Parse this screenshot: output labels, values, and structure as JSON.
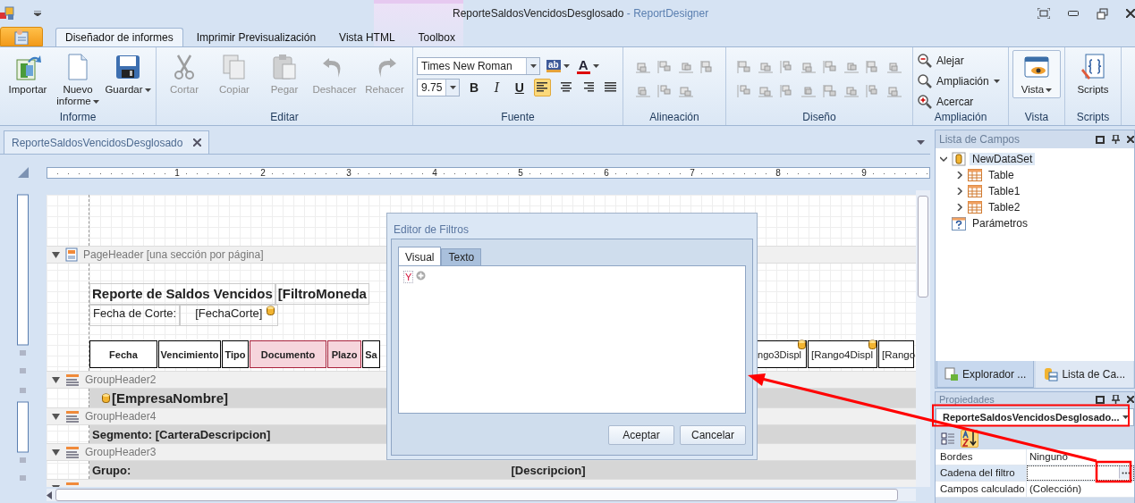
{
  "window": {
    "title": "ReporteSaldosVencidosDesglosado",
    "app_name": "- ReportDesigner"
  },
  "ribbon": {
    "tabs": [
      {
        "label": "Diseñador de informes",
        "selected": true
      },
      {
        "label": "Imprimir Previsualización",
        "selected": false
      },
      {
        "label": "Vista HTML",
        "selected": false
      },
      {
        "label": "Toolbox",
        "selected": false
      }
    ],
    "groups": [
      {
        "kind": "large",
        "label": "Informe",
        "buttons": [
          {
            "kind": "import",
            "label": "Importar",
            "disabled": false,
            "dropdown": false
          },
          {
            "kind": "new",
            "label": "Nuevo informe",
            "disabled": false,
            "dropdown": true
          },
          {
            "kind": "save",
            "label": "Guardar",
            "disabled": false,
            "dropdown": true
          }
        ]
      },
      {
        "kind": "large",
        "label": "Editar",
        "buttons": [
          {
            "kind": "cut",
            "label": "Cortar",
            "disabled": true,
            "dropdown": false
          },
          {
            "kind": "copy",
            "label": "Copiar",
            "disabled": true,
            "dropdown": false
          },
          {
            "kind": "paste",
            "label": "Pegar",
            "disabled": true,
            "dropdown": false
          },
          {
            "kind": "undo",
            "label": "Deshacer",
            "disabled": true,
            "dropdown": false
          },
          {
            "kind": "redo",
            "label": "Rehacer",
            "disabled": true,
            "dropdown": false
          }
        ]
      },
      {
        "kind": "font",
        "label": "Fuente",
        "font_name": "Times New Roman",
        "font_size": "9.75",
        "color_buttons": [
          {
            "kind": "highlight",
            "glyph": "ab"
          },
          {
            "kind": "font-color",
            "glyph": "A"
          }
        ],
        "styles": [
          {
            "kind": "bold",
            "label": "B",
            "selected": false
          },
          {
            "kind": "italic",
            "label": "I",
            "selected": false
          },
          {
            "kind": "underline",
            "label": "U",
            "selected": false
          }
        ],
        "alignments": [
          {
            "kind": "left",
            "selected": true
          },
          {
            "kind": "center",
            "selected": false
          },
          {
            "kind": "right",
            "selected": false
          },
          {
            "kind": "justify",
            "selected": false
          }
        ]
      },
      {
        "kind": "align",
        "label": "Alineación"
      },
      {
        "kind": "layout",
        "label": "Diseño"
      },
      {
        "kind": "zoom",
        "label": "Ampliación",
        "buttons": [
          {
            "kind": "zoom-out",
            "label": "Alejar",
            "dropdown": false
          },
          {
            "kind": "zoom",
            "label": "Ampliación",
            "dropdown": true
          },
          {
            "kind": "zoom-in",
            "label": "Acercar",
            "dropdown": false
          }
        ]
      },
      {
        "kind": "large",
        "label": "Vista",
        "buttons": [
          {
            "kind": "view",
            "label": "Vista",
            "disabled": false,
            "dropdown": true
          }
        ]
      },
      {
        "kind": "large",
        "label": "Scripts",
        "buttons": [
          {
            "kind": "scripts",
            "label": "Scripts",
            "disabled": false,
            "dropdown": false
          }
        ]
      }
    ]
  },
  "document": {
    "tab": {
      "title": "ReporteSaldosVencidosDesglosado",
      "selected": true
    },
    "ruler_labels": [
      "1",
      "2",
      "3",
      "4",
      "5",
      "6",
      "7",
      "8",
      "9"
    ],
    "page_header": {
      "title": "PageHeader [una sección por página]",
      "expanded": true,
      "title_cells": [
        "Reporte de Saldos Vencidos",
        "[FiltroMoneda"
      ],
      "info_cells": [
        {
          "text": "Fecha de Corte:",
          "bound": false
        },
        {
          "text": "[FechaCorte]",
          "bound": true
        }
      ],
      "columns_left": [
        {
          "text": "Fecha",
          "highlighted": false
        },
        {
          "text": "Vencimiento",
          "highlighted": false
        },
        {
          "text": "Tipo",
          "highlighted": false
        },
        {
          "text": "Documento",
          "highlighted": true
        },
        {
          "text": "Plazo",
          "highlighted": true
        },
        {
          "text": "Sa",
          "highlighted": false
        }
      ],
      "columns_right": [
        {
          "text": "ngo3Displ",
          "bound": true
        },
        {
          "text": "[Rango4Displ",
          "bound": true
        },
        {
          "text": "[Rango",
          "bound": false
        }
      ]
    },
    "group_bands": [
      {
        "title": "GroupHeader2",
        "expanded": true,
        "cells": [
          {
            "kind": "heading",
            "text": "[EmpresaNombre]",
            "bound": true
          }
        ]
      },
      {
        "title": "GroupHeader4",
        "expanded": true,
        "cells": [
          {
            "kind": "field",
            "text": "Segmento: [CarteraDescripcion]",
            "bound": false
          }
        ]
      },
      {
        "title": "GroupHeader3",
        "expanded": true,
        "cells": [
          {
            "kind": "field",
            "text": "Grupo:",
            "bound": false
          },
          {
            "kind": "field",
            "text": "[Descripcion]",
            "bound": false
          }
        ]
      }
    ]
  },
  "dialog": {
    "title": "Editor de Filtros",
    "tabs": [
      {
        "label": "Visual",
        "selected": true
      },
      {
        "label": "Texto",
        "selected": false
      }
    ],
    "group_operator": "Y",
    "buttons": [
      "Aceptar",
      "Cancelar"
    ]
  },
  "fields_panel": {
    "title": "Lista de Campos",
    "tree": [
      {
        "kind": "dataset",
        "label": "NewDataSet",
        "expanded": true,
        "selected": true,
        "children": [
          {
            "kind": "table",
            "label": "Table",
            "expanded": false,
            "selected": false
          },
          {
            "kind": "table",
            "label": "Table1",
            "expanded": false,
            "selected": false
          },
          {
            "kind": "table",
            "label": "Table2",
            "expanded": false,
            "selected": false
          }
        ]
      },
      {
        "kind": "parameters",
        "label": "Parámetros",
        "selected": false
      }
    ],
    "tabs": [
      {
        "kind": "explorer",
        "label": "Explorador ...",
        "selected": true
      },
      {
        "kind": "fields",
        "label": "Lista de Ca...",
        "selected": false
      }
    ]
  },
  "properties": {
    "title": "Propiedades",
    "object": "ReporteSaldosVencidosDesglosado...",
    "sort_buttons": [
      {
        "kind": "categorized",
        "selected": false
      },
      {
        "kind": "alphabetical",
        "selected": true
      }
    ],
    "rows": [
      {
        "name": "Bordes",
        "value": "Ninguno",
        "selected": false
      },
      {
        "name": "Cadena del filtro",
        "selected": true,
        "has_editor": true
      },
      {
        "name": "Campos calculado",
        "value": "(Colección)",
        "selected": false
      }
    ]
  }
}
